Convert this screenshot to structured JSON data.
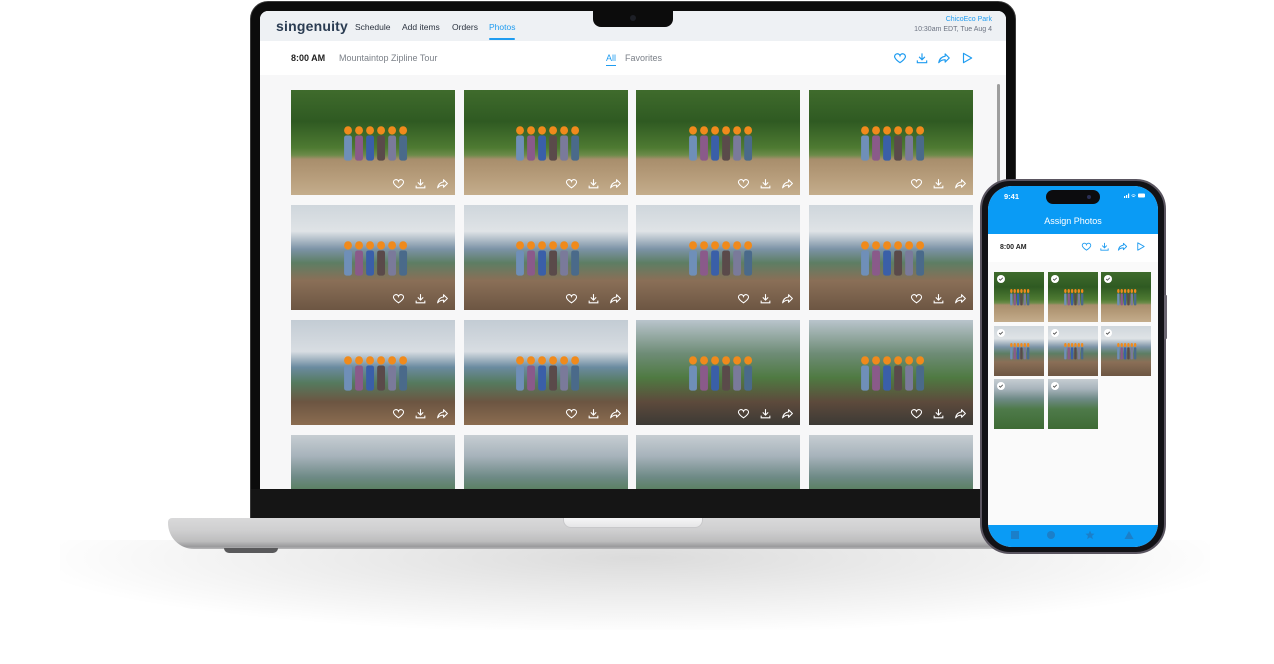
{
  "laptop": {
    "app": {
      "logo": "singenuity",
      "nav": [
        {
          "label": "Schedule",
          "active": false
        },
        {
          "label": "Add items",
          "active": false
        },
        {
          "label": "Orders",
          "active": false
        },
        {
          "label": "Photos",
          "active": true
        }
      ],
      "location": "ChicoEco Park",
      "datetime": "10:30am EDT, Tue Aug 4",
      "accent_color": "#1f9cf0"
    },
    "subheader": {
      "time": "8:00 AM",
      "title": "Mountaintop Zipline Tour",
      "filters": [
        {
          "label": "All",
          "active": true
        },
        {
          "label": "Favorites",
          "active": false
        }
      ],
      "actions": [
        "heart-icon",
        "download-icon",
        "share-icon",
        "play-icon"
      ]
    },
    "photos": [
      {
        "scene": "atv"
      },
      {
        "scene": "atv"
      },
      {
        "scene": "atv"
      },
      {
        "scene": "atv"
      },
      {
        "scene": "deck"
      },
      {
        "scene": "deck"
      },
      {
        "scene": "deck"
      },
      {
        "scene": "deck"
      },
      {
        "scene": "view"
      },
      {
        "scene": "view"
      },
      {
        "scene": "selfie"
      },
      {
        "scene": "selfie"
      },
      {
        "scene": "forest"
      },
      {
        "scene": "forest"
      },
      {
        "scene": "forest"
      },
      {
        "scene": "forest"
      }
    ],
    "photo_actions": [
      "heart-icon",
      "download-icon",
      "share-icon"
    ]
  },
  "phone": {
    "status_time": "9:41",
    "status_icons": "signal wifi battery",
    "title": "Assign Photos",
    "time": "8:00 AM",
    "actions": [
      "heart-icon",
      "download-icon",
      "share-icon",
      "play-icon"
    ],
    "photos": [
      {
        "scene": "atv",
        "selected": true
      },
      {
        "scene": "atv",
        "selected": true
      },
      {
        "scene": "atv",
        "selected": true
      },
      {
        "scene": "deck",
        "selected": true
      },
      {
        "scene": "deck",
        "selected": true
      },
      {
        "scene": "deck",
        "selected": true
      },
      {
        "scene": "forest",
        "selected": true
      },
      {
        "scene": "forest",
        "selected": true
      }
    ],
    "tabbar": [
      "square-icon",
      "circle-icon",
      "star-icon",
      "triangle-icon"
    ],
    "accent_color": "#0a9bf5"
  }
}
